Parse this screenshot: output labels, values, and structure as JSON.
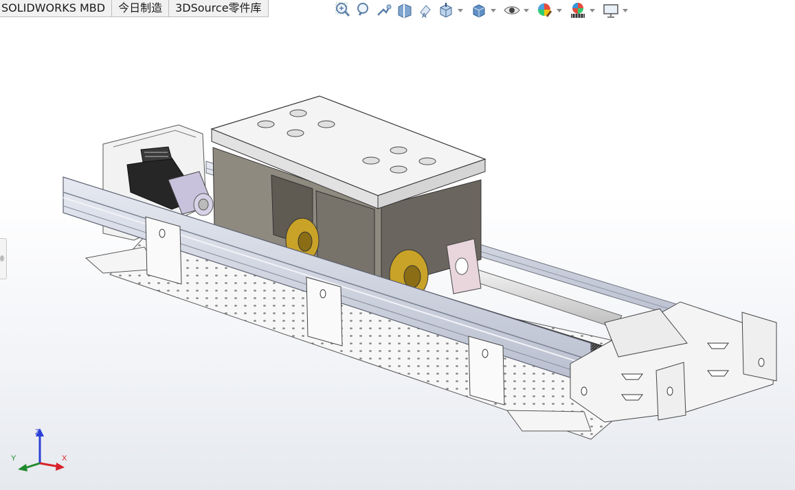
{
  "tabs": [
    {
      "label": "SOLIDWORKS MBD"
    },
    {
      "label": "今日制造"
    },
    {
      "label": "3DSource零件库"
    }
  ],
  "toolbar": {
    "icons": [
      "zoom-to-fit-icon",
      "zoom-to-area-icon",
      "previous-view-icon",
      "section-view-icon",
      "dynamic-annotation-views-icon",
      "view-orientation-icon",
      "display-style-icon",
      "hide-show-items-icon",
      "edit-appearance-icon",
      "apply-scene-icon",
      "view-settings-icon"
    ]
  },
  "triad": {
    "x_label": "X",
    "y_label": "Y",
    "z_label": "Z"
  },
  "colors": {
    "x_axis": "#d8222b",
    "y_axis": "#1f8a2d",
    "z_axis": "#2b3fd6",
    "carriage_top": "#f4f4f4",
    "carriage_side": "#8f8a80",
    "rail": "#c8ccd8",
    "motor": "#2a2a2a",
    "motor_flange": "#c9c2dc",
    "coupler": "#c9a228",
    "bearing_block": "#e9d6dc",
    "leadscrew": "#3a3a3a"
  }
}
